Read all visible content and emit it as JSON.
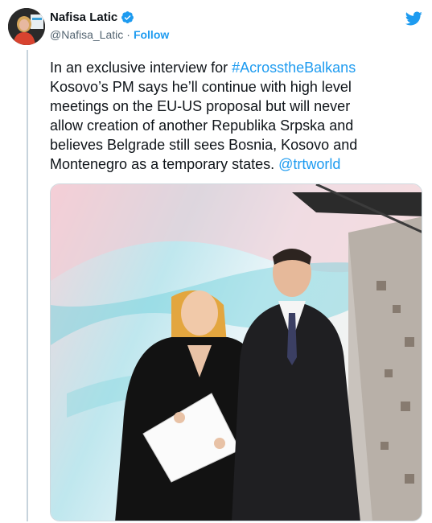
{
  "tweet": {
    "author_name": "Nafisa Latic",
    "author_handle": "@Nafisa_Latic",
    "separator": "·",
    "follow_label": "Follow",
    "text_lines": [
      [
        {
          "t": "In an exclusive interview for ",
          "link": false
        },
        {
          "t": "#AcrosstheBalkans",
          "link": true
        }
      ],
      [
        {
          "t": "Kosovo’s PM says he’ll continue with high level",
          "link": false
        }
      ],
      [
        {
          "t": "meetings on the EU-US proposal but will never",
          "link": false
        }
      ],
      [
        {
          "t": "allow creation of another Republika Srpska and",
          "link": false
        }
      ],
      [
        {
          "t": "believes Belgrade still sees Bosnia, Kosovo and",
          "link": false
        }
      ],
      [
        {
          "t": "Montenegro as a temporary states. ",
          "link": false
        },
        {
          "t": "@trtworld",
          "link": true
        }
      ]
    ]
  },
  "icons": {
    "verified": "verified-badge-icon",
    "brand": "twitter-bird-icon"
  },
  "colors": {
    "accent": "#1d9bf0",
    "text": "#0f1419",
    "secondary": "#536471",
    "rail": "#c7d3dc"
  }
}
